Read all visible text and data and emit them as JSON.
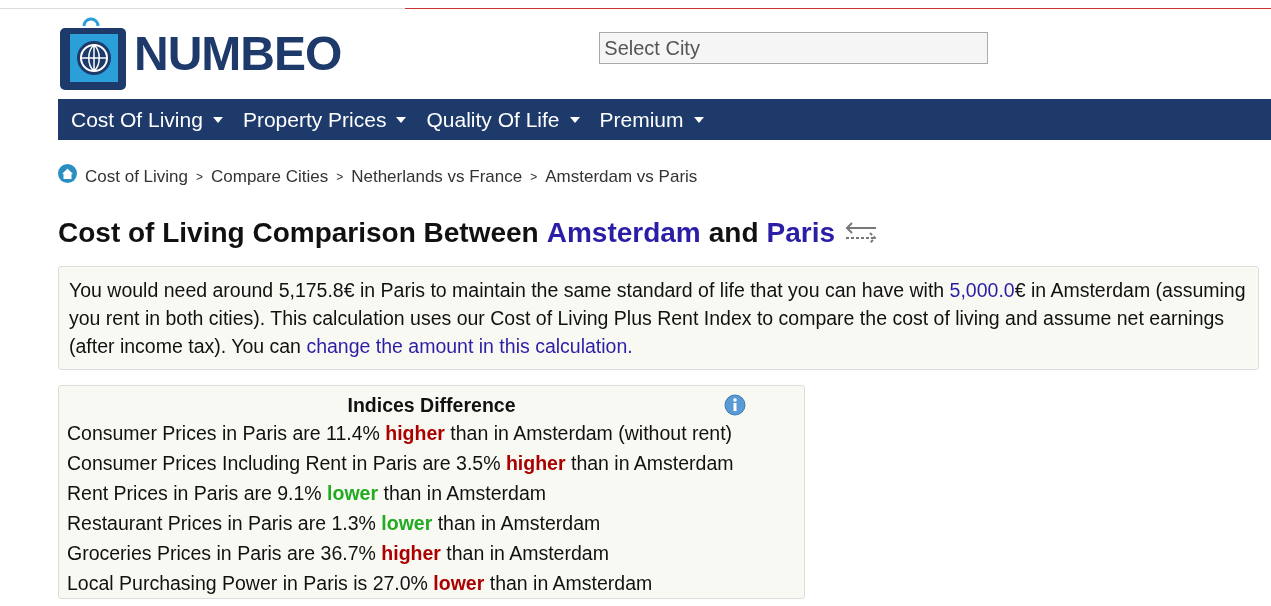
{
  "logo": {
    "text": "NUMBEO"
  },
  "city_search": {
    "placeholder": "Select City"
  },
  "nav": [
    {
      "label": "Cost Of Living"
    },
    {
      "label": "Property Prices"
    },
    {
      "label": "Quality Of Life"
    },
    {
      "label": "Premium"
    }
  ],
  "breadcrumb": [
    "Cost of Living",
    "Compare Cities",
    "Netherlands vs France",
    "Amsterdam vs Paris"
  ],
  "breadcrumb_separator": ">",
  "title": [
    {
      "kind": "text",
      "text": "Cost of Living Comparison Between"
    },
    {
      "kind": "link",
      "text": "Amsterdam"
    },
    {
      "kind": "text",
      "text": "and"
    },
    {
      "kind": "link",
      "text": "Paris"
    }
  ],
  "summary": [
    {
      "kind": "text",
      "text": "You would need around 5,175.8€ in Paris to maintain the same standard of life that you can have with "
    },
    {
      "kind": "link",
      "text": "5,000.0"
    },
    {
      "kind": "text",
      "text": "€ in Amsterdam (assuming you rent in both cities). This calculation uses our Cost of Living Plus Rent Index to compare the cost of living and assume net earnings (after income tax). You can "
    },
    {
      "kind": "link",
      "text": "change the amount in this calculation."
    }
  ],
  "indices": {
    "title": "Indices Difference",
    "rows": [
      {
        "before": "Consumer Prices in Paris are 11.4%",
        "word": "higher",
        "after": "than in Amsterdam (without rent)",
        "color": "#aa0000"
      },
      {
        "before": "Consumer Prices Including Rent in Paris are 3.5%",
        "word": "higher",
        "after": "than in Amsterdam",
        "color": "#aa0000"
      },
      {
        "before": "Rent Prices in Paris are 9.1%",
        "word": "lower",
        "after": "than in Amsterdam",
        "color": "#22aa22"
      },
      {
        "before": "Restaurant Prices in Paris are 1.3%",
        "word": "lower",
        "after": "than in Amsterdam",
        "color": "#22aa22"
      },
      {
        "before": "Groceries Prices in Paris are 36.7%",
        "word": "higher",
        "after": "than in Amsterdam",
        "color": "#aa0000"
      },
      {
        "before": "Local Purchasing Power in Paris is 27.0%",
        "word": "lower",
        "after": "than in Amsterdam",
        "color": "#aa0000"
      }
    ]
  }
}
